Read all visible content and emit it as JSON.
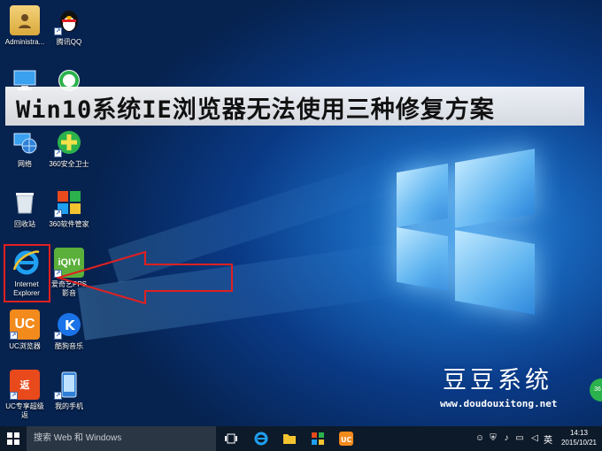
{
  "banner": {
    "title": "Win10系统IE浏览器无法使用三种修复方案"
  },
  "desktop_icons": [
    {
      "label": "Administra...",
      "icon": "user-folder-icon"
    },
    {
      "label": "腾讯QQ",
      "icon": "qq-penguin-icon"
    },
    {
      "label": "",
      "icon": "computer-icon"
    },
    {
      "label": "",
      "icon": "360-browser-icon"
    },
    {
      "label": "网络",
      "icon": "network-globe-icon"
    },
    {
      "label": "360安全卫士",
      "icon": "360-security-icon"
    },
    {
      "label": "回收站",
      "icon": "recycle-bin-icon"
    },
    {
      "label": "360软件管家",
      "icon": "360-software-manager-icon"
    },
    {
      "label": "Internet Explorer",
      "icon": "internet-explorer-icon"
    },
    {
      "label": "爱奇艺PPS影音",
      "icon": "iqiyi-icon"
    },
    {
      "label": "UC浏览器",
      "icon": "uc-browser-icon"
    },
    {
      "label": "酷狗音乐",
      "icon": "kugou-icon"
    },
    {
      "label": "UC专享超级返",
      "icon": "uc-rebate-icon"
    },
    {
      "label": "我的手机",
      "icon": "my-phone-icon"
    }
  ],
  "brand": {
    "name": "豆豆系统",
    "url": "www.doudouxitong.net"
  },
  "taskbar": {
    "search_placeholder": "搜索 Web 和 Windows",
    "ime": "英",
    "time": "14:13",
    "date": "2015/10/21"
  },
  "colors": {
    "highlight": "#e02020",
    "taskbar": "#0d1a2a",
    "accent": "#1a73e8"
  }
}
